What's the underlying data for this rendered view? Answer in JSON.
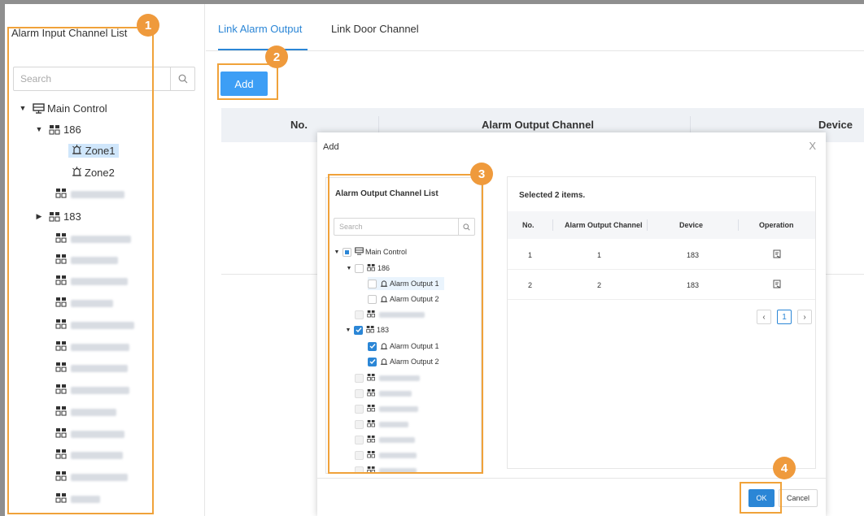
{
  "left_panel": {
    "title": "Alarm Input Channel List",
    "search_placeholder": "Search",
    "tree": {
      "root": "Main Control",
      "device_1": "186",
      "zone_1": "Zone1",
      "zone_2": "Zone2",
      "device_3": "183"
    }
  },
  "tabs": {
    "link_alarm_output": "Link Alarm Output",
    "link_door_channel": "Link Door Channel"
  },
  "toolbar": {
    "add_label": "Add"
  },
  "main_table": {
    "headers": [
      "No.",
      "Alarm Output Channel",
      "Device"
    ]
  },
  "dialog": {
    "title": "Add",
    "close": "X",
    "output_list": {
      "title": "Alarm Output Channel List",
      "search_placeholder": "Search",
      "root": "Main Control",
      "device_186": "186",
      "device_183": "183",
      "output_1": "Alarm Output 1",
      "output_2": "Alarm Output 2"
    },
    "selected": {
      "summary": "Selected 2 items.",
      "headers": [
        "No.",
        "Alarm Output Channel",
        "Device",
        "Operation"
      ],
      "rows": [
        {
          "no": "1",
          "channel": "1",
          "device": "183"
        },
        {
          "no": "2",
          "channel": "2",
          "device": "183"
        }
      ],
      "current_page": "1"
    },
    "ok_label": "OK",
    "cancel_label": "Cancel"
  },
  "callouts": [
    "1",
    "2",
    "3",
    "4"
  ],
  "colors": {
    "accent": "#2b86d6",
    "callout": "#ef9a3c",
    "add_button": "#3d9ef5"
  }
}
